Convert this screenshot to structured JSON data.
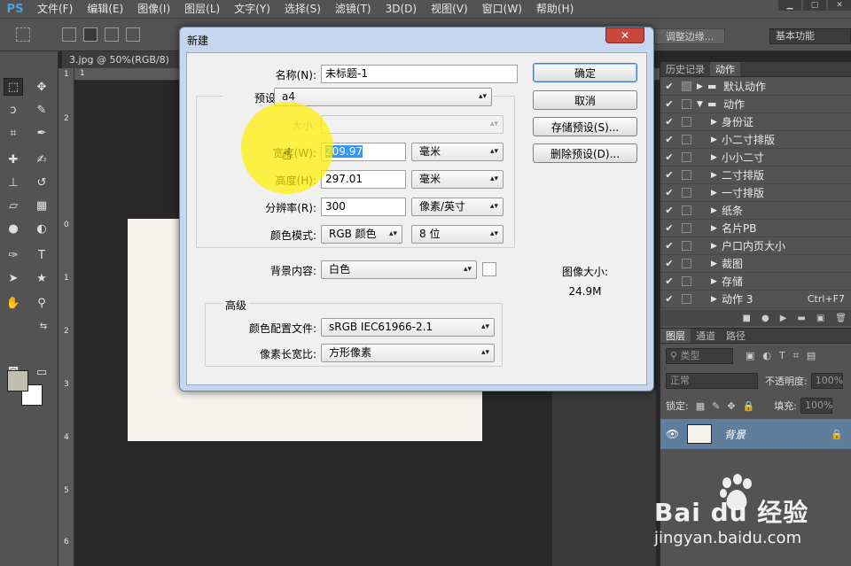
{
  "app": {
    "logo": "PS"
  },
  "menubar": {
    "items": [
      "文件(F)",
      "编辑(E)",
      "图像(I)",
      "图层(L)",
      "文字(Y)",
      "选择(S)",
      "滤镜(T)",
      "3D(D)",
      "视图(V)",
      "窗口(W)",
      "帮助(H)"
    ]
  },
  "optionsbar": {
    "refine_edge": "调整边缘...",
    "workspace": "基本功能"
  },
  "document": {
    "tab_title": "3.jpg @ 50%(RGB/8)",
    "ruler_top_ticks": [
      "1"
    ],
    "ruler_left_ticks": [
      "1",
      "2",
      "0",
      "1",
      "2",
      "3",
      "4",
      "5",
      "6"
    ]
  },
  "dialog": {
    "title": "新建",
    "close_glyph": "✕",
    "name_label": "名称(N):",
    "name_value": "未标题-1",
    "preset_label": "预设:",
    "preset_value": "a4",
    "size_label": "大小:",
    "width_label": "宽度(W):",
    "width_value": "209.97",
    "width_unit": "毫米",
    "height_label": "高度(H):",
    "height_value": "297.01",
    "height_unit": "毫米",
    "resolution_label": "分辨率(R):",
    "resolution_value": "300",
    "resolution_unit": "像素/英寸",
    "color_mode_label": "颜色模式:",
    "color_mode_value": "RGB 颜色",
    "bit_depth_value": "8 位",
    "bg_content_label": "背景内容:",
    "bg_content_value": "白色",
    "advanced_label": "高级",
    "color_profile_label": "颜色配置文件:",
    "color_profile_value": "sRGB IEC61966-2.1",
    "pixel_aspect_label": "像素长宽比:",
    "pixel_aspect_value": "方形像素",
    "ok_button": "确定",
    "cancel_button": "取消",
    "save_preset_button": "存储预设(S)...",
    "delete_preset_button": "删除预设(D)...",
    "image_size_label": "图像大小:",
    "image_size_value": "24.9M"
  },
  "history_panel": {
    "tabs": [
      "历史记录",
      "动作"
    ],
    "actions": [
      {
        "label": "默认动作",
        "shortcut": ""
      },
      {
        "label": "动作",
        "shortcut": ""
      },
      {
        "label": "身份证",
        "shortcut": ""
      },
      {
        "label": "小二寸排版",
        "shortcut": ""
      },
      {
        "label": "小小二寸",
        "shortcut": ""
      },
      {
        "label": "二寸排版",
        "shortcut": ""
      },
      {
        "label": "一寸排版",
        "shortcut": ""
      },
      {
        "label": "纸条",
        "shortcut": ""
      },
      {
        "label": "名片PB",
        "shortcut": ""
      },
      {
        "label": "户口内页大小",
        "shortcut": ""
      },
      {
        "label": "裁图",
        "shortcut": ""
      },
      {
        "label": "存储",
        "shortcut": ""
      },
      {
        "label": "动作 3",
        "shortcut": "Ctrl+F7"
      }
    ]
  },
  "layers_panel": {
    "tabs": [
      "图层",
      "通道",
      "路径"
    ],
    "filter_kind": "类型",
    "blend_mode": "正常",
    "opacity_label": "不透明度:",
    "opacity_value": "100%",
    "lock_label": "锁定:",
    "fill_label": "填充:",
    "fill_value": "100%",
    "layer_name": "背景"
  },
  "watermark": {
    "brand": "Bai du 经验",
    "url": "jingyan.baidu.com"
  },
  "colors": {
    "foreground": "#c3bfb0",
    "background": "#ffffff",
    "selected_layer": "#5f7e9e",
    "dialog_frame": "#c4d7ee",
    "highlight": "#fff000"
  }
}
